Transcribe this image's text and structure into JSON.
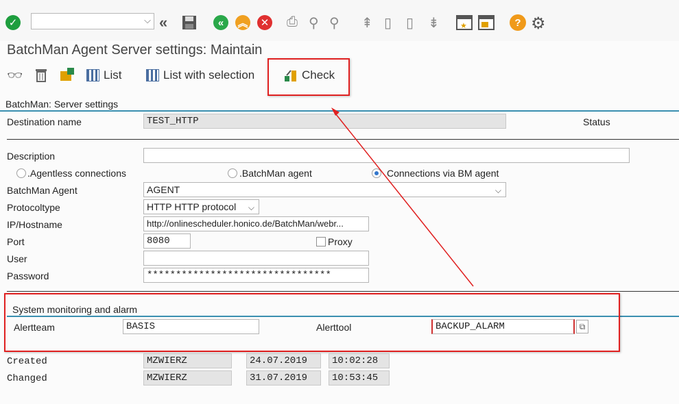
{
  "toolbar": {
    "command_field_value": "",
    "icons": [
      "enter-check-icon",
      "double-left-arrow-icon",
      "save-icon",
      "back-icon",
      "exit-icon",
      "cancel-icon",
      "print-icon",
      "find-icon",
      "find-next-icon",
      "first-page-icon",
      "previous-page-icon",
      "next-page-icon",
      "last-page-icon",
      "new-session-icon",
      "shortcut-icon",
      "help-icon",
      "settings-gear-icon"
    ]
  },
  "page": {
    "title": "BatchMan Agent Server settings: Maintain"
  },
  "app_toolbar": {
    "list_label": "List",
    "list_selection_label": "List with selection",
    "check_label": "Check"
  },
  "section_server": {
    "title": "BatchMan: Server settings"
  },
  "destination": {
    "label": "Destination name",
    "value": "TEST_HTTP",
    "status_label": "Status"
  },
  "description": {
    "label": "Description",
    "value": ""
  },
  "connection": {
    "option_agentless": ".Agentless connections",
    "option_agent": ".BatchMan agent",
    "option_via_bm": "Connections via BM agent",
    "selected": "via_bm"
  },
  "agent": {
    "label": "BatchMan Agent",
    "value": "AGENT"
  },
  "protocol": {
    "label": "Protocoltype",
    "value": "HTTP HTTP protocol"
  },
  "host": {
    "label": "IP/Hostname",
    "value": "http://onlinescheduler.honico.de/BatchMan/webr..."
  },
  "port": {
    "label": "Port",
    "value": "8080",
    "proxy_label": "Proxy",
    "proxy_checked": false
  },
  "user": {
    "label": "User",
    "value": ""
  },
  "password": {
    "label": "Password",
    "value": "********************************"
  },
  "monitoring": {
    "title": "System monitoring and alarm",
    "alertteam_label": "Alertteam",
    "alertteam_value": "BASIS",
    "alerttool_label": "Alerttool",
    "alerttool_value": "BACKUP_ALARM"
  },
  "audit": {
    "created_label": "Created",
    "created_user": "MZWIERZ",
    "created_date": "24.07.2019",
    "created_time": "10:02:28",
    "changed_label": "Changed",
    "changed_user": "MZWIERZ",
    "changed_date": "31.07.2019",
    "changed_time": "10:53:45"
  },
  "colors": {
    "highlight": "#e02020",
    "section_rule": "#3a8fb0",
    "ok_green": "#1e9e3e",
    "back_green": "#2aa84a",
    "exit_orange": "#f0a020",
    "cancel_red": "#e03030",
    "help_orange": "#f09a1a"
  }
}
